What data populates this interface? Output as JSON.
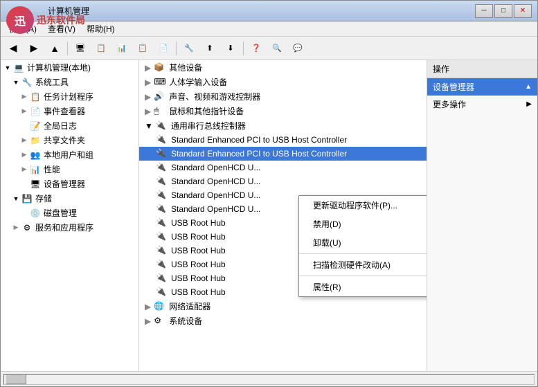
{
  "window": {
    "title": "计算机管理",
    "watermark": "迅东软件局",
    "min_btn": "─",
    "max_btn": "□",
    "close_btn": "✕"
  },
  "menubar": {
    "items": [
      {
        "label": "操作(A)"
      },
      {
        "label": "查看(V)"
      },
      {
        "label": "帮助(H)"
      }
    ]
  },
  "left_tree": {
    "items": [
      {
        "label": "计算机管理(本地)",
        "indent": 1,
        "expanded": true,
        "icon": "💻"
      },
      {
        "label": "系统工具",
        "indent": 2,
        "expanded": true,
        "icon": "🔧"
      },
      {
        "label": "任务计划程序",
        "indent": 3,
        "icon": "📋"
      },
      {
        "label": "事件查看器",
        "indent": 3,
        "icon": "📄"
      },
      {
        "label": "全局日志",
        "indent": 3,
        "icon": "📝"
      },
      {
        "label": "共享文件夹",
        "indent": 3,
        "icon": "📁"
      },
      {
        "label": "本地用户和组",
        "indent": 3,
        "icon": "👥"
      },
      {
        "label": "性能",
        "indent": 3,
        "icon": "📊"
      },
      {
        "label": "设备管理器",
        "indent": 3,
        "icon": "🖥"
      },
      {
        "label": "存储",
        "indent": 2,
        "expanded": true,
        "icon": "💾"
      },
      {
        "label": "磁盘管理",
        "indent": 3,
        "icon": "💿"
      },
      {
        "label": "服务和应用程序",
        "indent": 2,
        "icon": "⚙"
      }
    ]
  },
  "device_list": {
    "categories": [
      {
        "label": "其他设备",
        "expanded": false,
        "indent": 0
      },
      {
        "label": "人体学输入设备",
        "expanded": false,
        "indent": 0
      },
      {
        "label": "声音、视频和游戏控制器",
        "expanded": false,
        "indent": 0
      },
      {
        "label": "鼠标和其他指针设备",
        "expanded": false,
        "indent": 0
      },
      {
        "label": "通用串行总线控制器",
        "expanded": true,
        "indent": 0
      },
      {
        "label": "Standard Enhanced PCI to USB Host Controller",
        "indent": 1,
        "selected": false
      },
      {
        "label": "Standard Enhanced PCI to USB Host Controller",
        "indent": 1,
        "selected": true,
        "context": true
      },
      {
        "label": "Standard OpenHCD U...",
        "indent": 1
      },
      {
        "label": "Standard OpenHCD U...",
        "indent": 1
      },
      {
        "label": "Standard OpenHCD U...",
        "indent": 1
      },
      {
        "label": "Standard OpenHCD U...",
        "indent": 1
      },
      {
        "label": "USB Root Hub",
        "indent": 1
      },
      {
        "label": "USB Root Hub",
        "indent": 1
      },
      {
        "label": "USB Root Hub",
        "indent": 1
      },
      {
        "label": "USB Root Hub",
        "indent": 1
      },
      {
        "label": "USB Root Hub",
        "indent": 1
      },
      {
        "label": "USB Root Hub",
        "indent": 1
      },
      {
        "label": "网络适配器",
        "expanded": false,
        "indent": 0
      },
      {
        "label": "系统设备",
        "expanded": false,
        "indent": 0
      }
    ]
  },
  "context_menu": {
    "items": [
      {
        "label": "更新驱动程序软件(P)...",
        "type": "item"
      },
      {
        "label": "禁用(D)",
        "type": "item"
      },
      {
        "label": "卸载(U)",
        "type": "item"
      },
      {
        "type": "separator"
      },
      {
        "label": "扫描检测硬件改动(A)",
        "type": "item"
      },
      {
        "type": "separator"
      },
      {
        "label": "属性(R)",
        "type": "item"
      }
    ]
  },
  "ops_panel": {
    "title": "操作",
    "items": [
      {
        "label": "设备管理器",
        "selected": true,
        "has_arrow": true
      },
      {
        "label": "更多操作",
        "has_arrow": true
      }
    ]
  }
}
